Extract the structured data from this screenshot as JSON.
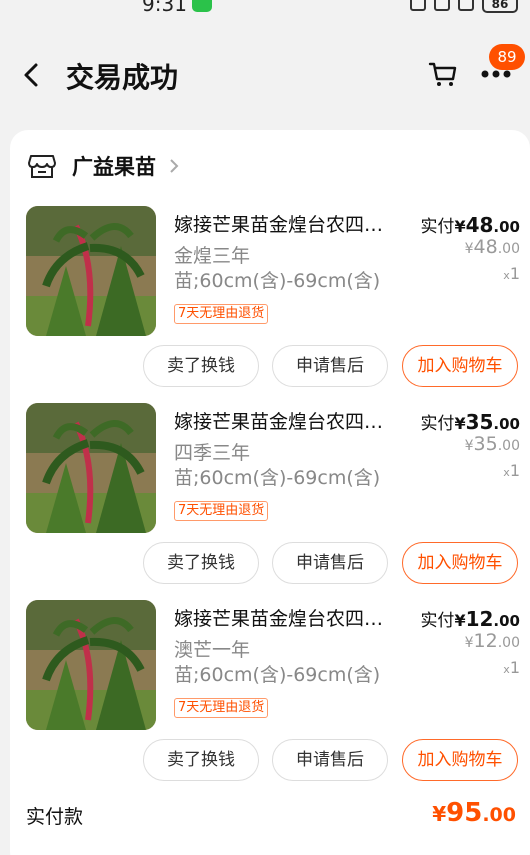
{
  "status_bar": {
    "time": "9:31",
    "battery": "86"
  },
  "header": {
    "title": "交易成功",
    "cart_badge": "89"
  },
  "shop": {
    "name": "广益果苗"
  },
  "items": [
    {
      "title": "嫁接芒果苗金煌台农四…",
      "spec": "金煌三年苗;60cm(含)-69cm(含)",
      "tag": "7天无理由退货",
      "paid_label": "实付",
      "currency": "¥",
      "paid_int": "48",
      "paid_dec": ".00",
      "orig_int": "48",
      "orig_dec": ".00",
      "qty_x": "x",
      "qty": "1",
      "btn_sell": "卖了换钱",
      "btn_after": "申请售后",
      "btn_cart": "加入购物车"
    },
    {
      "title": "嫁接芒果苗金煌台农四…",
      "spec": "四季三年苗;60cm(含)-69cm(含)",
      "tag": "7天无理由退货",
      "paid_label": "实付",
      "currency": "¥",
      "paid_int": "35",
      "paid_dec": ".00",
      "orig_int": "35",
      "orig_dec": ".00",
      "qty_x": "x",
      "qty": "1",
      "btn_sell": "卖了换钱",
      "btn_after": "申请售后",
      "btn_cart": "加入购物车"
    },
    {
      "title": "嫁接芒果苗金煌台农四…",
      "spec": "澳芒一年苗;60cm(含)-69cm(含)",
      "tag": "7天无理由退货",
      "paid_label": "实付",
      "currency": "¥",
      "paid_int": "12",
      "paid_dec": ".00",
      "orig_int": "12",
      "orig_dec": ".00",
      "qty_x": "x",
      "qty": "1",
      "btn_sell": "卖了换钱",
      "btn_after": "申请售后",
      "btn_cart": "加入购物车"
    }
  ],
  "total": {
    "label": "实付款",
    "currency": "¥",
    "int": "95",
    "dec": ".00"
  },
  "colors": {
    "accent": "#ff5000",
    "background": "#f2f2f2",
    "card": "#ffffff"
  },
  "icons": [
    "back-icon",
    "cart-icon",
    "more-icon",
    "shop-icon",
    "chevron-right-icon",
    "wechat-icon"
  ]
}
